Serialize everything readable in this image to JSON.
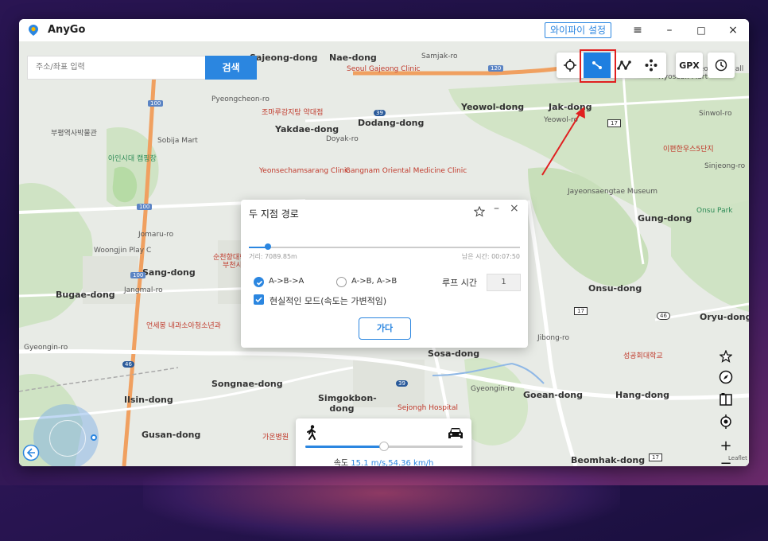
{
  "app": {
    "title": "AnyGo"
  },
  "titlebar": {
    "wifi_label": "와이파이 설정",
    "menu": "≡",
    "minimize": "–",
    "maximize": "□",
    "close": "×"
  },
  "search": {
    "placeholder": "주소/좌표 입력",
    "button": "검색"
  },
  "toolbar": {
    "gpx_label": "GPX"
  },
  "map": {
    "labels": [
      "Sajeong-dong",
      "Nae-dong",
      "Samjak-ro",
      "Seoul Gajeong Clinic",
      "Pyeongcheon-ro",
      "조마루감지탕 약대점",
      "Yakdae-dong",
      "Dodang-dong",
      "Doyak-ro",
      "Yeowol-dong",
      "Jak-dong",
      "Yeowol-ro",
      "Seongsin Hall",
      "Hyosebk Mart",
      "Sinwol-ro",
      "이편한우스5단지",
      "Sinjeong-ro",
      "부평역사박물관",
      "Sobija Mart",
      "아인시대 캠핑장",
      "Yeonsechamsarang Clinic",
      "Gangnam Oriental Medicine Clinic",
      "Jayeonsaengtae Museum",
      "Gung-dong",
      "Onsu Park",
      "Jomaru-ro",
      "Woongjin Play C",
      "Sang-dong",
      "Bugae-dong",
      "Jangmal-ro",
      "Onsu-dong",
      "Oryu-dong",
      "언세봉 내과소아청소년과",
      "Gyeongin-ro",
      "Sosa-dong",
      "Jibong-ro",
      "성공회대학교",
      "Songnae-dong",
      "Simgokbon-dong",
      "Gyeongin-ro",
      "Goean-dong",
      "Hang-dong",
      "Ilsin-dong",
      "Sejongh Hospital",
      "Gusan-dong",
      "가온병원",
      "Beomhak-dong",
      "Leaflet",
      "부천시",
      "순천향대학교 부천병원"
    ],
    "badges": [
      "120",
      "100",
      "100",
      "100",
      "39",
      "39",
      "17",
      "17",
      "17",
      "46",
      "46"
    ]
  },
  "dialog": {
    "title": "두 지점 경로",
    "distance": "거리: 7089.85m",
    "remaining": "남은 시간: 00:07:50",
    "progress": 0.07,
    "option_ab": "A->B->A",
    "option_abab": "A->B, A->B",
    "loop_label": "루프 시간",
    "loop_value": "1",
    "realistic_label": "현실적인 모드(속도는 가변적임)",
    "go_button": "가다"
  },
  "speed": {
    "label": "속도",
    "value": "15.1 m/s,54.36 km/h",
    "level": 0.5
  },
  "colors": {
    "accent": "#2b86e0",
    "highlight": "#e02020"
  }
}
